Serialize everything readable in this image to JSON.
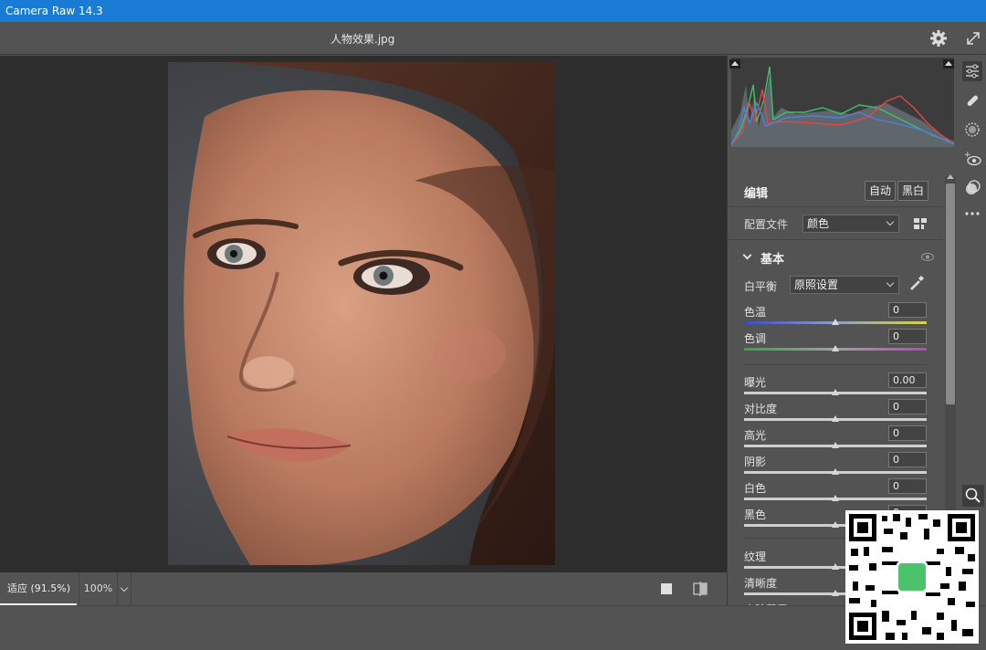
{
  "window": {
    "title": "Camera Raw 14.3"
  },
  "topbar": {
    "filename": "人物效果.jpg",
    "settings_icon": "gear-icon",
    "fullscreen_icon": "expand-icon"
  },
  "bottombar": {
    "zoom_fit": "适应 (91.5%)",
    "zoom_100": "100%"
  },
  "edit": {
    "title": "编辑",
    "auto_label": "自动",
    "bw_label": "黑白",
    "profile_label": "配置文件",
    "profile_value": "颜色",
    "basic_title": "基本",
    "wb_label": "白平衡",
    "wb_value": "原照设置",
    "sliders": [
      {
        "label": "色温",
        "value": "0"
      },
      {
        "label": "色调",
        "value": "0"
      },
      {
        "label": "曝光",
        "value": "0.00"
      },
      {
        "label": "对比度",
        "value": "0"
      },
      {
        "label": "高光",
        "value": "0"
      },
      {
        "label": "阴影",
        "value": "0"
      },
      {
        "label": "白色",
        "value": "0"
      },
      {
        "label": "黑色",
        "value": "0"
      },
      {
        "label": "纹理",
        "value": ""
      },
      {
        "label": "清晰度",
        "value": ""
      },
      {
        "label": "去除薄雾",
        "value": ""
      }
    ]
  },
  "tools": [
    "sliders-icon",
    "healing-brush-icon",
    "mask-icon",
    "redeye-icon",
    "presets-icon",
    "more-icon",
    "zoom-icon"
  ]
}
